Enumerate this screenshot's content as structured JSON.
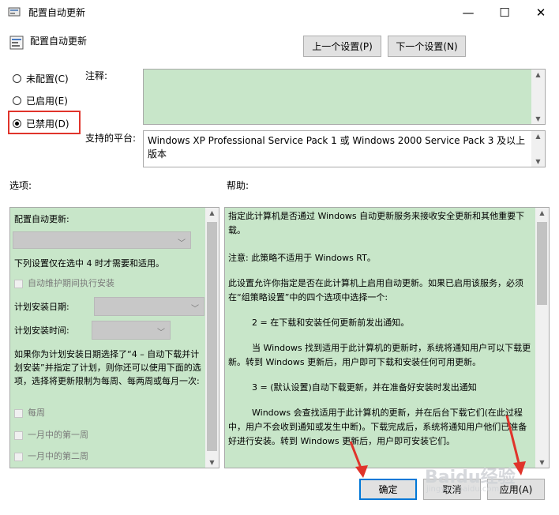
{
  "window": {
    "title": "配置自动更新",
    "minimize": "—",
    "maximize": "☐",
    "close": "✕"
  },
  "header": {
    "policy_name": "配置自动更新",
    "prev_button": "上一个设置(P)",
    "next_button": "下一个设置(N)"
  },
  "state": {
    "options": [
      {
        "label": "未配置(C)",
        "checked": false
      },
      {
        "label": "已启用(E)",
        "checked": false
      },
      {
        "label": "已禁用(D)",
        "checked": true
      }
    ],
    "highlight_color": "#e0342b"
  },
  "comment": {
    "label": "注释:",
    "value": ""
  },
  "platform": {
    "label": "支持的平台:",
    "value": "Windows XP Professional Service Pack 1 或 Windows 2000 Service Pack 3 及以上版本"
  },
  "options_panel": {
    "label": "选项:",
    "title": "配置自动更新:",
    "note": "下列设置仅在选中 4 时才需要和适用。",
    "maint_checkbox": "自动维护期间执行安装",
    "day_label": "计划安装日期:",
    "time_label": "计划安装时间:",
    "para": "如果你为计划安装日期选择了“4 – 自动下载并计划安装”并指定了计划，则你还可以使用下面的选项，选择将更新限制为每周、每两周或每月一次:",
    "weekly": "每周",
    "first_week": "一月中的第一周",
    "second_week": "一月中的第二周"
  },
  "help_panel": {
    "label": "帮助:",
    "paragraphs": [
      "指定此计算机是否通过 Windows 自动更新服务来接收安全更新和其他重要下载。",
      "注意: 此策略不适用于 Windows RT。",
      "此设置允许你指定是否在此计算机上启用自动更新。如果已启用该服务，必须在“组策略设置”中的四个选项中选择一个:",
      "2 = 在下载和安装任何更新前发出通知。",
      "当 Windows 找到适用于此计算机的更新时，系统将通知用户可以下载更新。转到 Windows 更新后，用户即可下载和安装任何可用更新。",
      "3 = (默认设置)自动下载更新，并在准备好安装时发出通知",
      "Windows 会查找适用于此计算机的更新，并在后台下载它们(在此过程中，用户不会收到通知或发生中断)。下载完成后，系统将通知用户他们已准备好进行安装。转到 Windows 更新后，用户即可安装它们。"
    ]
  },
  "footer": {
    "ok": "确定",
    "cancel": "取消",
    "apply": "应用(A)"
  },
  "watermark": {
    "brand": "Baidu经验",
    "url": "jingyan.baidu.com"
  }
}
